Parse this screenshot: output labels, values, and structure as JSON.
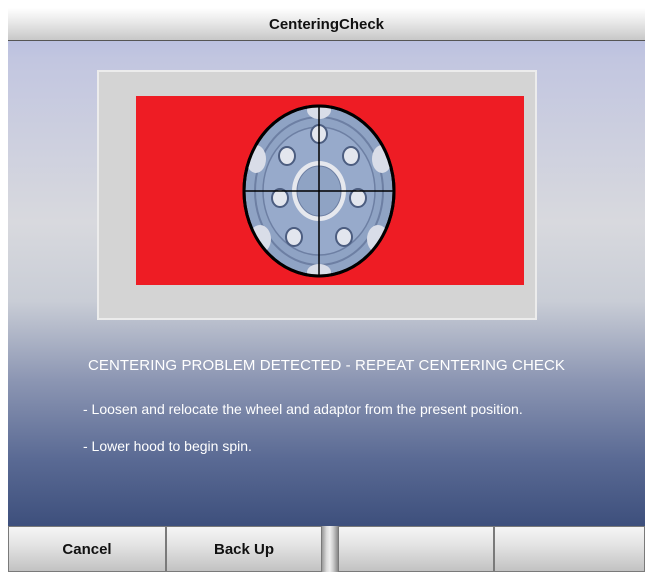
{
  "window": {
    "title": "CenteringCheck"
  },
  "colors": {
    "panel_red": "#ee1c24",
    "wheel_blue": "#8fa3c4",
    "text": "#ffffff"
  },
  "message": {
    "heading": "CENTERING PROBLEM DETECTED - REPEAT CENTERING CHECK",
    "instructions": [
      "- Loosen and relocate the wheel and adaptor from the present position.",
      "- Lower hood to begin spin."
    ]
  },
  "buttons": [
    {
      "label": "Cancel"
    },
    {
      "label": "Back Up"
    },
    {
      "label": ""
    },
    {
      "label": ""
    }
  ],
  "graphic": {
    "icon": "wheel-centering-target-icon"
  }
}
